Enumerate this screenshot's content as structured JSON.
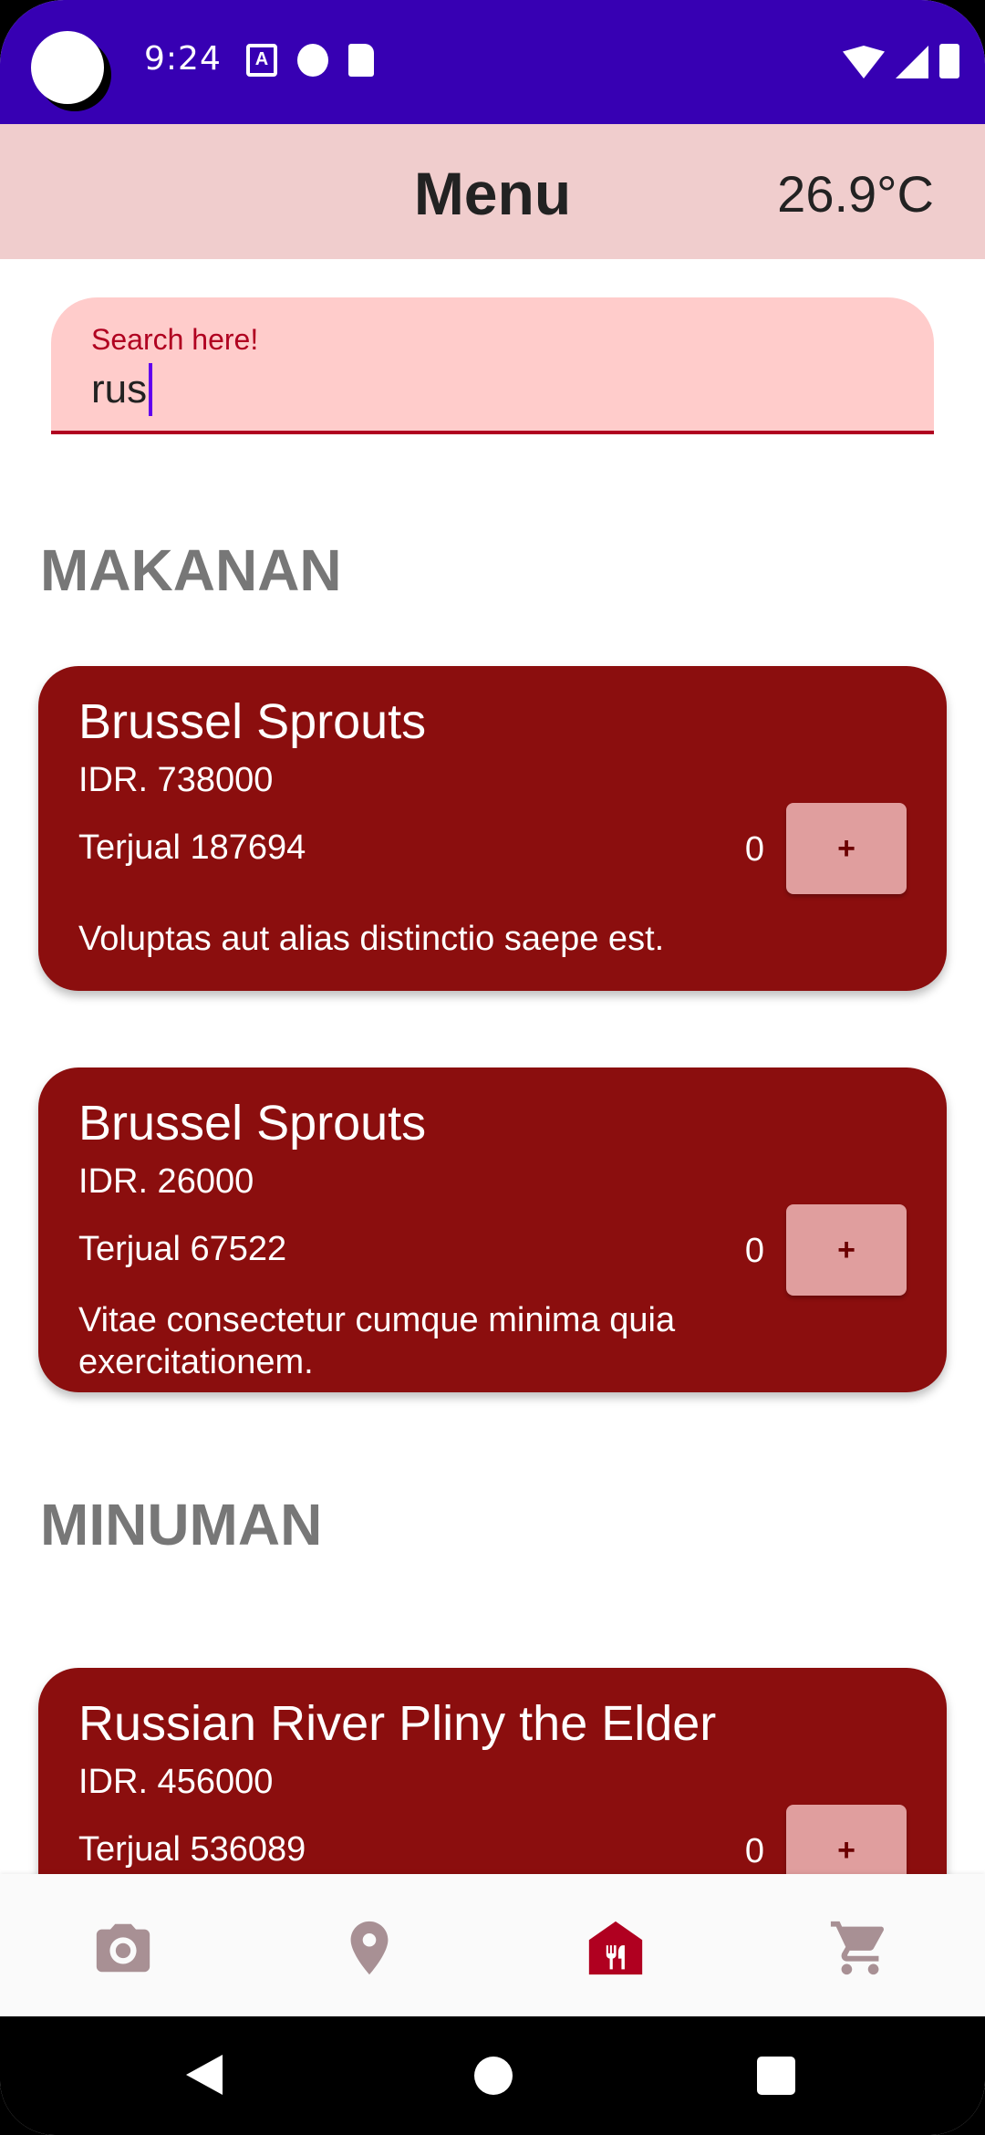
{
  "status_bar": {
    "time": "9:24",
    "icons": [
      "a-icon",
      "t-circle-icon",
      "sd-card-icon",
      "wifi-icon",
      "signal-icon",
      "battery-icon"
    ],
    "background": "#3700b3"
  },
  "app_bar": {
    "title": "Menu",
    "temperature": "26.9°C",
    "background": "#f0cdcd"
  },
  "search": {
    "label": "Search here!",
    "value": "rus",
    "accent": "#b00020"
  },
  "sections": [
    {
      "heading": "MAKANAN",
      "items": [
        {
          "name": "Brussel Sprouts",
          "price": "IDR. 738000",
          "sold": "Terjual 187694",
          "qty": "0",
          "add_label": "+",
          "description": "Voluptas aut alias distinctio saepe est."
        },
        {
          "name": "Brussel Sprouts",
          "price": "IDR. 26000",
          "sold": "Terjual 67522",
          "qty": "0",
          "add_label": "+",
          "description": "Vitae consectetur cumque minima quia exercitationem."
        }
      ]
    },
    {
      "heading": "MINUMAN",
      "items": [
        {
          "name": "Russian River Pliny the Elder",
          "price": "IDR. 456000",
          "sold": "Terjual 536089",
          "qty": "0",
          "add_label": "+"
        }
      ]
    }
  ],
  "bottom_nav": {
    "items": [
      "camera-icon",
      "location-pin-icon",
      "restaurant-menu-icon",
      "cart-icon"
    ],
    "active": "restaurant-menu-icon",
    "active_color": "#b00020",
    "inactive_color": "#a89094"
  },
  "colors": {
    "card": "#8b0e0e",
    "add_button": "#e09e9e",
    "heading": "#777777"
  }
}
